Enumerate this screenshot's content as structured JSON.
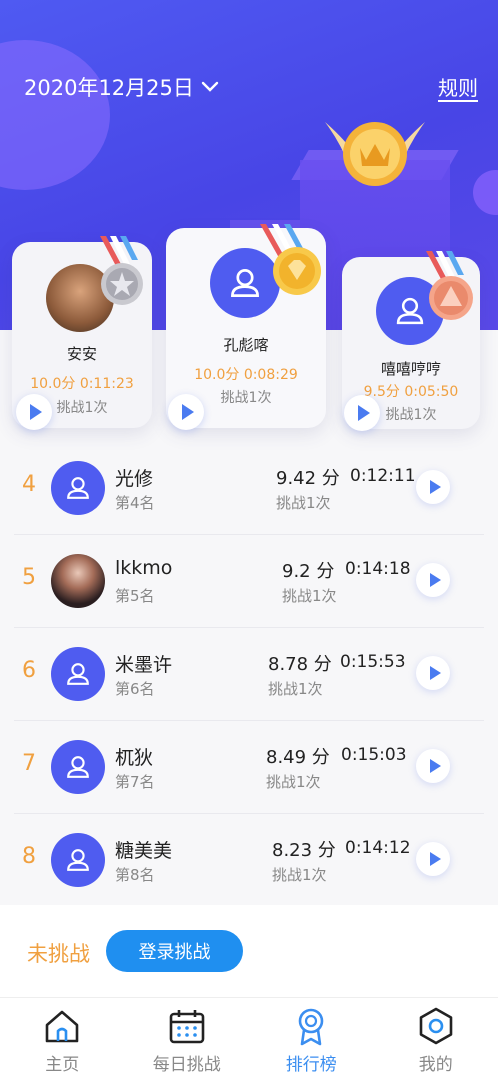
{
  "header": {
    "date": "2020年12月25日",
    "rules_label": "规则"
  },
  "podium": [
    {
      "rank": 2,
      "name": "安安",
      "score": "10.0分",
      "time": "0:11:23",
      "tries": "挑战1次",
      "medal": "silver"
    },
    {
      "rank": 1,
      "name": "孔彪喀",
      "score": "10.0分",
      "time": "0:08:29",
      "tries": "挑战1次",
      "medal": "gold"
    },
    {
      "rank": 3,
      "name": "嘻嘻哼哼",
      "score": "9.5分",
      "time": "0:05:50",
      "tries": "挑战1次",
      "medal": "bronze"
    }
  ],
  "ranking": [
    {
      "rank": "4",
      "name": "光修",
      "place": "第4名",
      "score": "9.42 分",
      "time": "0:12:11",
      "tries": "挑战1次",
      "avatar": "user-icon"
    },
    {
      "rank": "5",
      "name": "lkkmo",
      "place": "第5名",
      "score": "9.2 分",
      "time": "0:14:18",
      "tries": "挑战1次",
      "avatar": "photo"
    },
    {
      "rank": "6",
      "name": "米墨许",
      "place": "第6名",
      "score": "8.78 分",
      "time": "0:15:53",
      "tries": "挑战1次",
      "avatar": "user-icon"
    },
    {
      "rank": "7",
      "name": "杌狄",
      "place": "第7名",
      "score": "8.49 分",
      "time": "0:15:03",
      "tries": "挑战1次",
      "avatar": "user-icon"
    },
    {
      "rank": "8",
      "name": "糖美美",
      "place": "第8名",
      "score": "8.23 分",
      "time": "0:14:12",
      "tries": "挑战1次",
      "avatar": "user-icon"
    }
  ],
  "footer": {
    "status": "未挑战",
    "login_button": "登录挑战"
  },
  "tabs": [
    {
      "label": "主页",
      "icon": "home-icon"
    },
    {
      "label": "每日挑战",
      "icon": "calendar-icon"
    },
    {
      "label": "排行榜",
      "icon": "ribbon-icon",
      "active": true
    },
    {
      "label": "我的",
      "icon": "profile-hex-icon"
    }
  ],
  "colors": {
    "brand": "#4f5af2",
    "accent_orange": "#f0a040",
    "button_blue": "#1f8ff0",
    "active_tab": "#3b8ef0"
  }
}
